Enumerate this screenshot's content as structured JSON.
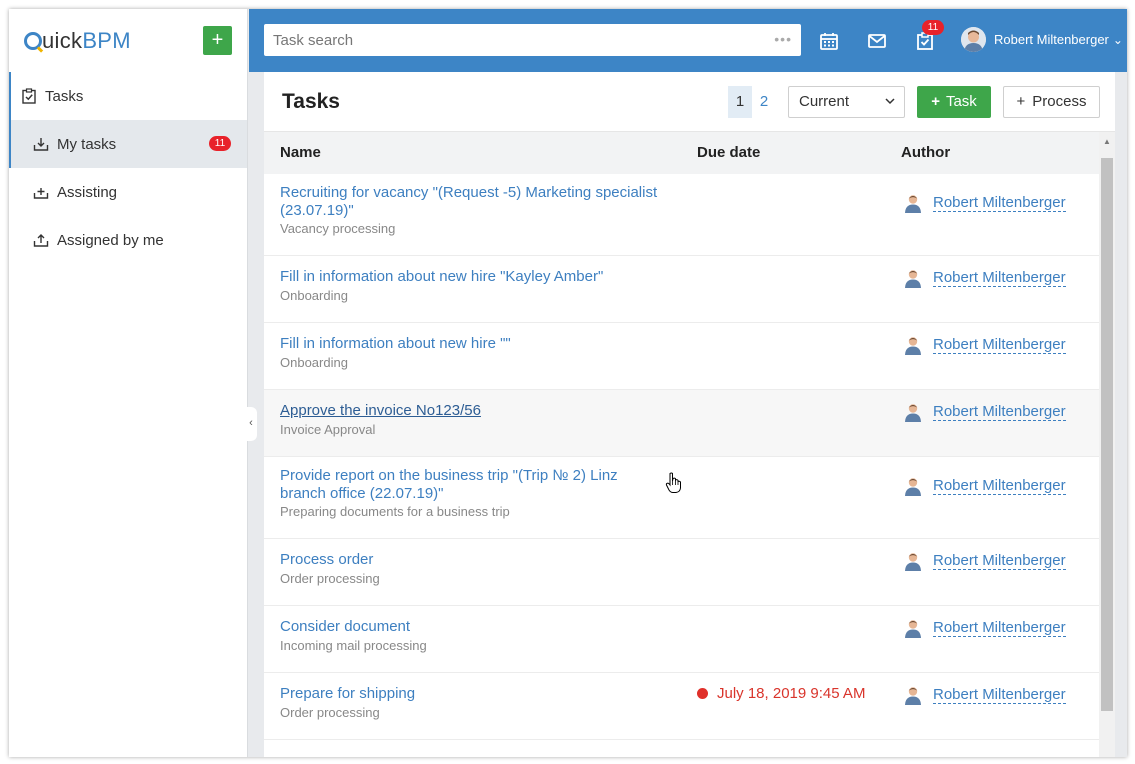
{
  "app": {
    "logo_prefix": "Q",
    "logo_mid": "uick",
    "logo_suffix": "BPM",
    "add_label": "+"
  },
  "sidebar": {
    "root_label": "Tasks",
    "items": [
      {
        "label": "My tasks",
        "badge": "11",
        "active": true
      },
      {
        "label": "Assisting"
      },
      {
        "label": "Assigned by me"
      }
    ],
    "collapse_glyph": "‹"
  },
  "topbar": {
    "search_placeholder": "Task search",
    "search_dots": "•••",
    "tasks_badge": "11",
    "user_name": "Robert Miltenberger",
    "user_chevron": "⌄"
  },
  "main": {
    "title": "Tasks",
    "pages": [
      "1",
      "2"
    ],
    "current_page": "1",
    "filter_value": "Current",
    "task_button": "Task",
    "process_button": "Process",
    "columns": [
      "Name",
      "Due date",
      "Author"
    ]
  },
  "tasks": [
    {
      "title": "Recruiting for vacancy \"(Request -5) Marketing specialist (23.07.19)\"",
      "subtitle": "Vacancy processing",
      "due": "",
      "author": "Robert Miltenberger"
    },
    {
      "title": "Fill in information about new hire \"Kayley Amber\"",
      "subtitle": "Onboarding",
      "due": "",
      "author": "Robert Miltenberger"
    },
    {
      "title": "Fill in information about new hire \"\"",
      "subtitle": "Onboarding",
      "due": "",
      "author": "Robert Miltenberger"
    },
    {
      "title": "Approve the invoice No123/56",
      "subtitle": "Invoice Approval",
      "due": "",
      "author": "Robert Miltenberger"
    },
    {
      "title": "Provide report on the business trip \"(Trip № 2) Linz branch office (22.07.19)\"",
      "subtitle": "Preparing documents for a business trip",
      "due": "",
      "author": "Robert Miltenberger"
    },
    {
      "title": "Process order",
      "subtitle": "Order processing",
      "due": "",
      "author": "Robert Miltenberger"
    },
    {
      "title": "Consider document",
      "subtitle": "Incoming mail processing",
      "due": "",
      "author": "Robert Miltenberger"
    },
    {
      "title": "Prepare for shipping",
      "subtitle": "Order processing",
      "due": "July 18, 2019 9:45 AM",
      "author": "Robert Miltenberger"
    }
  ],
  "colors": {
    "accent": "#3d85c6",
    "green": "#3ea64a",
    "badge_red": "#e8222a",
    "overdue_red": "#d9342b"
  }
}
